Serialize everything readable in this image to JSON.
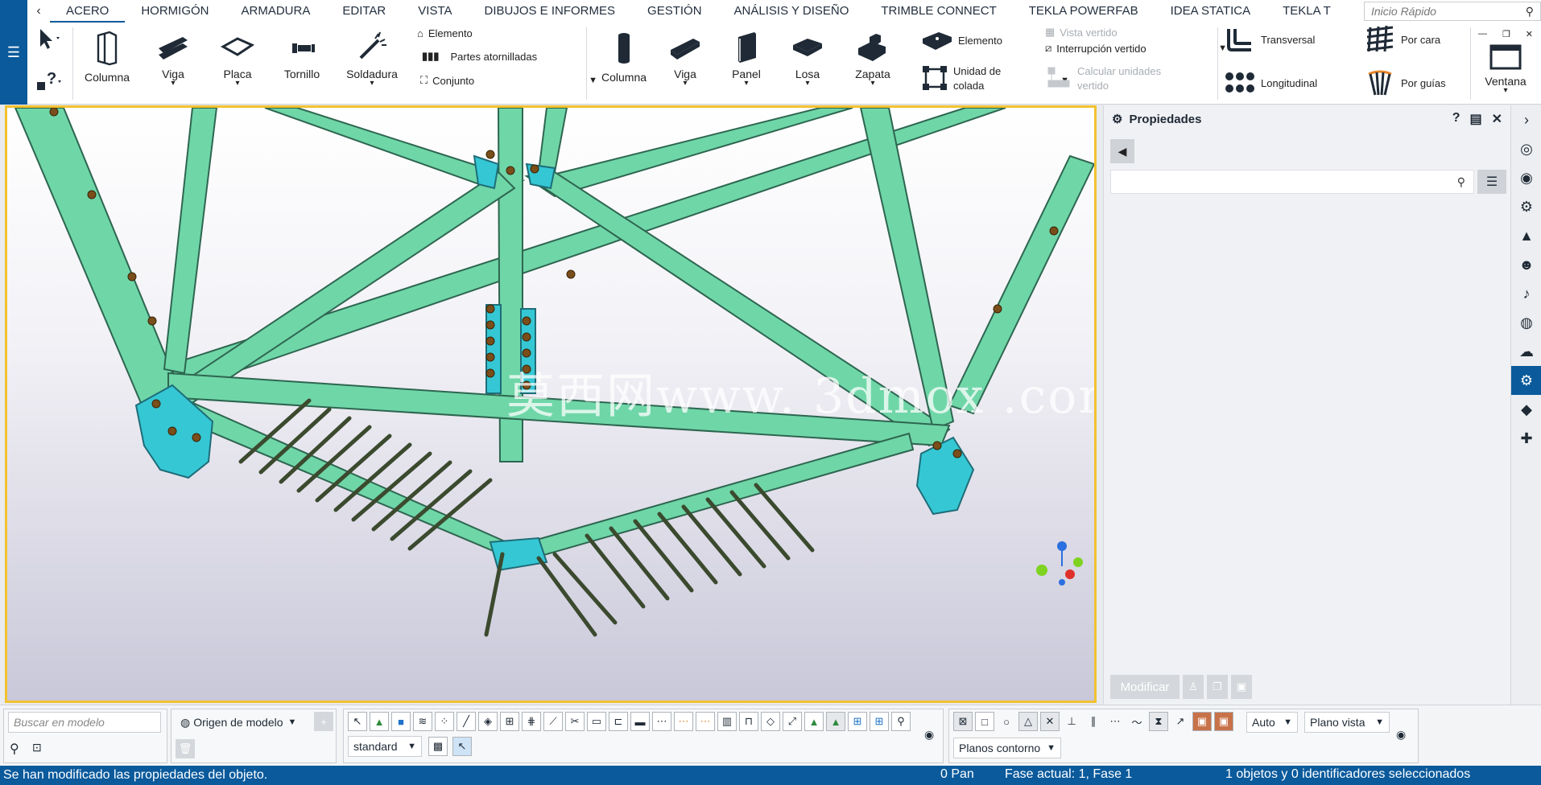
{
  "tabs": [
    "ACERO",
    "HORMIGÓN",
    "ARMADURA",
    "EDITAR",
    "VISTA",
    "DIBUJOS E INFORMES",
    "GESTIÓN",
    "ANÁLISIS Y DISEÑO",
    "TRIMBLE CONNECT",
    "TEKLA POWERFAB",
    "IDEA STATICA",
    "TEKLA T"
  ],
  "active_tab": "ACERO",
  "quick_search_placeholder": "Inicio Rápido",
  "ribbon": {
    "steel": {
      "columna": "Columna",
      "viga": "Viga",
      "placa": "Placa",
      "tornillo": "Tornillo",
      "soldadura": "Soldadura",
      "elemento": "Elemento",
      "partes": "Partes atornilladas",
      "conjunto": "Conjunto"
    },
    "concrete": {
      "columna": "Columna",
      "viga": "Viga",
      "panel": "Panel",
      "losa": "Losa",
      "zapata": "Zapata",
      "elemento": "Elemento",
      "unidad": "Unidad de",
      "colada": "colada",
      "vista_vertido": "Vista vertido",
      "interrupcion": "Interrupción vertido",
      "calcular": "Calcular unidades",
      "vertido": "vertido"
    },
    "rebar": {
      "transversal": "Transversal",
      "longitudinal": "Longitudinal",
      "por_cara": "Por cara",
      "por_guias": "Por guías"
    },
    "ventana": "Ventana"
  },
  "viewport": {
    "watermark": "莫西网www. 3dmox .com",
    "axis": {
      "z": "Z",
      "y": "Y"
    }
  },
  "properties": {
    "title": "Propiedades",
    "modify_label": "Modificar"
  },
  "bottom": {
    "search_placeholder": "Buscar en modelo",
    "origin": "Origen de modelo",
    "standard": "standard",
    "auto": "Auto",
    "plano_vista": "Plano vista",
    "planos_contorno": "Planos contorno"
  },
  "status": {
    "message": "Se han modificado las propiedades del objeto.",
    "pan": "0  Pan",
    "phase": "Fase actual: 1, Fase 1",
    "selection": "1 objetos y 0 identificadores seleccionados"
  },
  "colors": {
    "accent": "#0a5a9c",
    "steel_member": "#6fd6a8",
    "plate": "#35c7d4",
    "viewport_border": "#f2c230"
  }
}
